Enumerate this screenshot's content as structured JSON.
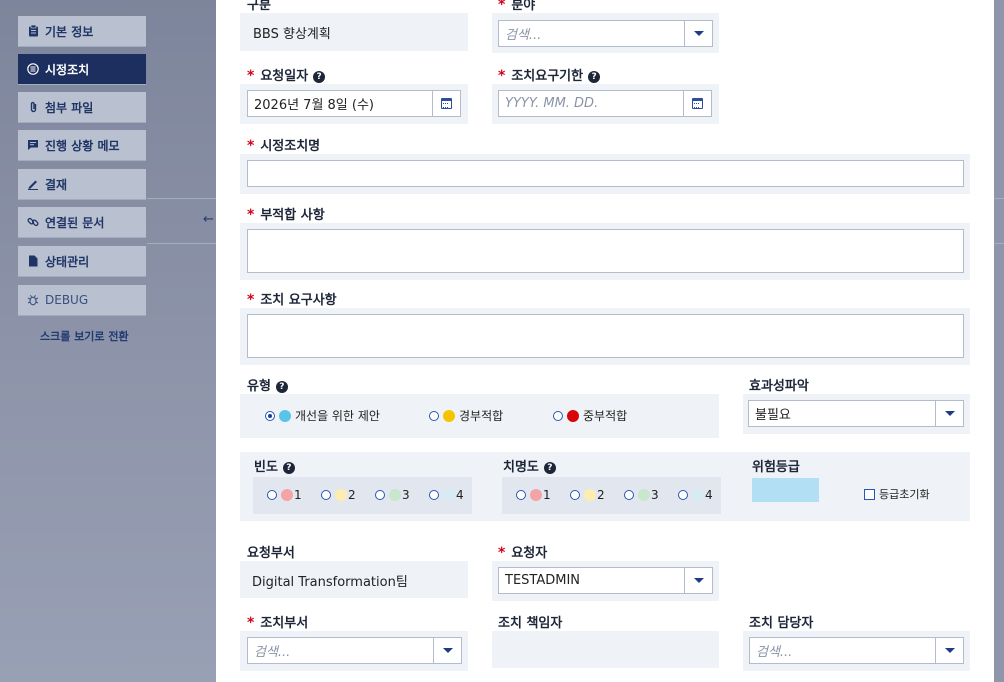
{
  "sidebar": {
    "items": [
      {
        "label": "기본 정보",
        "icon": "clipboard-icon",
        "active": false
      },
      {
        "label": "시정조치",
        "icon": "circle-list-icon",
        "active": true
      },
      {
        "label": "첨부 파일",
        "icon": "paperclip-icon",
        "active": false
      },
      {
        "label": "진행 상황 메모",
        "icon": "message-icon",
        "active": false
      },
      {
        "label": "결재",
        "icon": "pen-icon",
        "active": false
      },
      {
        "label": "연결된 문서",
        "icon": "link-icon",
        "active": false
      },
      {
        "label": "상태관리",
        "icon": "document-icon",
        "active": false
      },
      {
        "label": "DEBUG",
        "icon": "bug-icon",
        "active": false
      }
    ],
    "scroll_toggle": "스크롤 보기로 전환"
  },
  "form": {
    "category": {
      "label": "구분",
      "value": "BBS 향상계획"
    },
    "field": {
      "label": "분야",
      "placeholder": "검색..."
    },
    "request_date": {
      "label": "요청일자",
      "value": "2026년 7월 8일 (수)"
    },
    "due_date": {
      "label": "조치요구기한",
      "placeholder": "YYYY. MM. DD."
    },
    "title": {
      "label": "시정조치명",
      "value": ""
    },
    "nonconformity": {
      "label": "부적합 사항",
      "value": ""
    },
    "requirement": {
      "label": "조치 요구사항",
      "value": ""
    },
    "type": {
      "label": "유형",
      "options": [
        {
          "label": "개선을 위한 제안",
          "color": "#5bc3ea",
          "selected": true
        },
        {
          "label": "경부적합",
          "color": "#f5c400",
          "selected": false
        },
        {
          "label": "중부적합",
          "color": "#d6050c",
          "selected": false
        }
      ]
    },
    "effectiveness": {
      "label": "효과성파악",
      "value": "불필요"
    },
    "frequency": {
      "label": "빈도",
      "options": [
        {
          "label": "1",
          "color": "#f4a3a6"
        },
        {
          "label": "2",
          "color": "#fbeeb0"
        },
        {
          "label": "3",
          "color": "#c8e7cc"
        },
        {
          "label": "4",
          "color": "#d6ecf5"
        }
      ]
    },
    "severity": {
      "label": "치명도",
      "options": [
        {
          "label": "1",
          "color": "#f4a3a6"
        },
        {
          "label": "2",
          "color": "#fbeeb0"
        },
        {
          "label": "3",
          "color": "#c8e7cc"
        },
        {
          "label": "4",
          "color": "#d6ecf5"
        }
      ]
    },
    "risk_grade": {
      "label": "위험등급",
      "color": "#b3dff5",
      "reset_label": "등급초기화"
    },
    "request_dept": {
      "label": "요청부서",
      "value": "Digital Transformation팀"
    },
    "requester": {
      "label": "요청자",
      "value": "TESTADMIN"
    },
    "action_dept": {
      "label": "조치부서",
      "placeholder": "검색..."
    },
    "action_owner": {
      "label": "조치 책임자",
      "value": ""
    },
    "action_assignee": {
      "label": "조치 담당자",
      "placeholder": "검색..."
    }
  },
  "colors": {
    "accent": "#1c2f5e",
    "required": "#d0021b"
  }
}
